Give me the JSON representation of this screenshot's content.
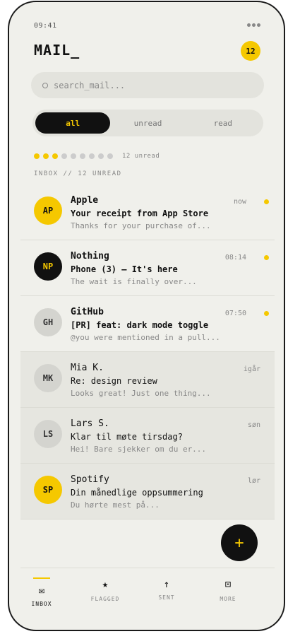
{
  "status": {
    "time": "09:41"
  },
  "header": {
    "title": "MAIL_",
    "badge": "12"
  },
  "search": {
    "placeholder": "search_mail..."
  },
  "filter": {
    "tabs": [
      "all",
      "unread",
      "read"
    ],
    "active": "all"
  },
  "progress": {
    "filled": 3,
    "total": 9,
    "label": "12 unread"
  },
  "section_label": "INBOX // 12 UNREAD",
  "mails": [
    {
      "initials": "AP",
      "sender": "Apple",
      "subject": "Your receipt from App Store",
      "preview": "Thanks for your purchase of...",
      "time": "now",
      "unread": true
    },
    {
      "initials": "NP",
      "sender": "Nothing",
      "subject": "Phone (3) — It's here",
      "preview": "The wait is finally over...",
      "time": "08:14",
      "unread": true
    },
    {
      "initials": "GH",
      "sender": "GitHub",
      "subject": "[PR] feat: dark mode toggle",
      "preview": "@you were mentioned in a pull...",
      "time": "07:50",
      "unread": true
    },
    {
      "initials": "MK",
      "sender": "Mia K.",
      "subject": "Re: design review",
      "preview": "Looks great! Just one thing...",
      "time": "igår",
      "unread": false
    },
    {
      "initials": "LS",
      "sender": "Lars S.",
      "subject": "Klar til møte tirsdag?",
      "preview": "Hei! Bare sjekker om du er...",
      "time": "søn",
      "unread": false
    },
    {
      "initials": "SP",
      "sender": "Spotify",
      "subject": "Din månedlige oppsummering",
      "preview": "Du hørte mest på...",
      "time": "lør",
      "unread": false
    }
  ],
  "fab": {
    "label": "+"
  },
  "nav": [
    {
      "label": "INBOX",
      "icon": "mail-icon",
      "glyph": "✉"
    },
    {
      "label": "FLAGGED",
      "icon": "star-icon",
      "glyph": "★"
    },
    {
      "label": "SENT",
      "icon": "arrow-up-icon",
      "glyph": "↑"
    },
    {
      "label": "MORE",
      "icon": "square-dot-icon",
      "glyph": "⊡"
    }
  ],
  "colors": {
    "accent": "#f5c800",
    "dark": "#111111",
    "background": "#f0f0eb"
  }
}
